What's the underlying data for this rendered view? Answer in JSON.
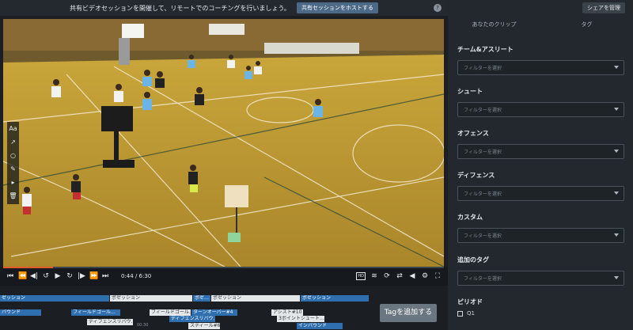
{
  "banner": {
    "message": "共有ビデオセッションを開催して、リモートでのコーチングを行いましょう。",
    "host_button": "共有セッションをホストする",
    "help_icon": "?"
  },
  "draw_tools": [
    "Aa",
    "↗",
    "○",
    "✎",
    "▸",
    "🗑"
  ],
  "player": {
    "time": "0:44 / 6:30",
    "progress_fraction": 0.113,
    "buttons_left": [
      "⏮",
      "⏪",
      "◀|",
      "↺",
      "▶",
      "↻",
      "|▶",
      "⏩",
      "⏭"
    ],
    "hd_badge": "HD"
  },
  "timeline": {
    "rows": [
      {
        "clips": [
          {
            "label": "ゼッション",
            "style": "blue"
          },
          {
            "label": "ポゼッション",
            "style": "light"
          },
          {
            "label": "ポゼ…",
            "style": "blue"
          },
          {
            "label": "ポゼッション",
            "style": "light"
          },
          {
            "label": "ポゼッション",
            "style": "blue"
          }
        ]
      },
      {
        "clips": [
          {
            "label": "バウンド",
            "style": "blue"
          },
          {
            "label": "フィールドゴール…",
            "style": "blue"
          },
          {
            "label": "フィールドゴール…",
            "style": "light"
          },
          {
            "label": "ターンオーバー#4",
            "style": "blue"
          },
          {
            "label": "アシスト#10",
            "style": "light"
          }
        ]
      },
      {
        "clips": [
          {
            "label": "ディフェンスリバウ…",
            "style": "light"
          },
          {
            "label": "ディフェンスリバウ…",
            "style": "blue"
          },
          {
            "label": "3ポイントシュート…",
            "style": "light"
          }
        ]
      },
      {
        "clips": [
          {
            "label": "スティール#6",
            "style": "light"
          },
          {
            "label": "インバウンド",
            "style": "blue"
          }
        ]
      }
    ],
    "tick_label": "00:30",
    "add_tag_button": "Tagを追加する"
  },
  "panel": {
    "manage_share": "シェアを管理",
    "tabs": [
      "あなたのクリップ",
      "タグ"
    ],
    "filter_placeholder": "フィルターを選択",
    "filters": [
      {
        "label": "チーム&アスリート"
      },
      {
        "label": "シュート"
      },
      {
        "label": "オフェンス"
      },
      {
        "label": "ディフェンス"
      },
      {
        "label": "カスタム"
      },
      {
        "label": "追加のタグ"
      }
    ],
    "period_label": "ピリオド",
    "period_options": [
      "Q1"
    ]
  },
  "colors": {
    "accent_blue": "#2f6fb0",
    "progress": "#e05a2a",
    "panel_bg": "#22282e"
  }
}
